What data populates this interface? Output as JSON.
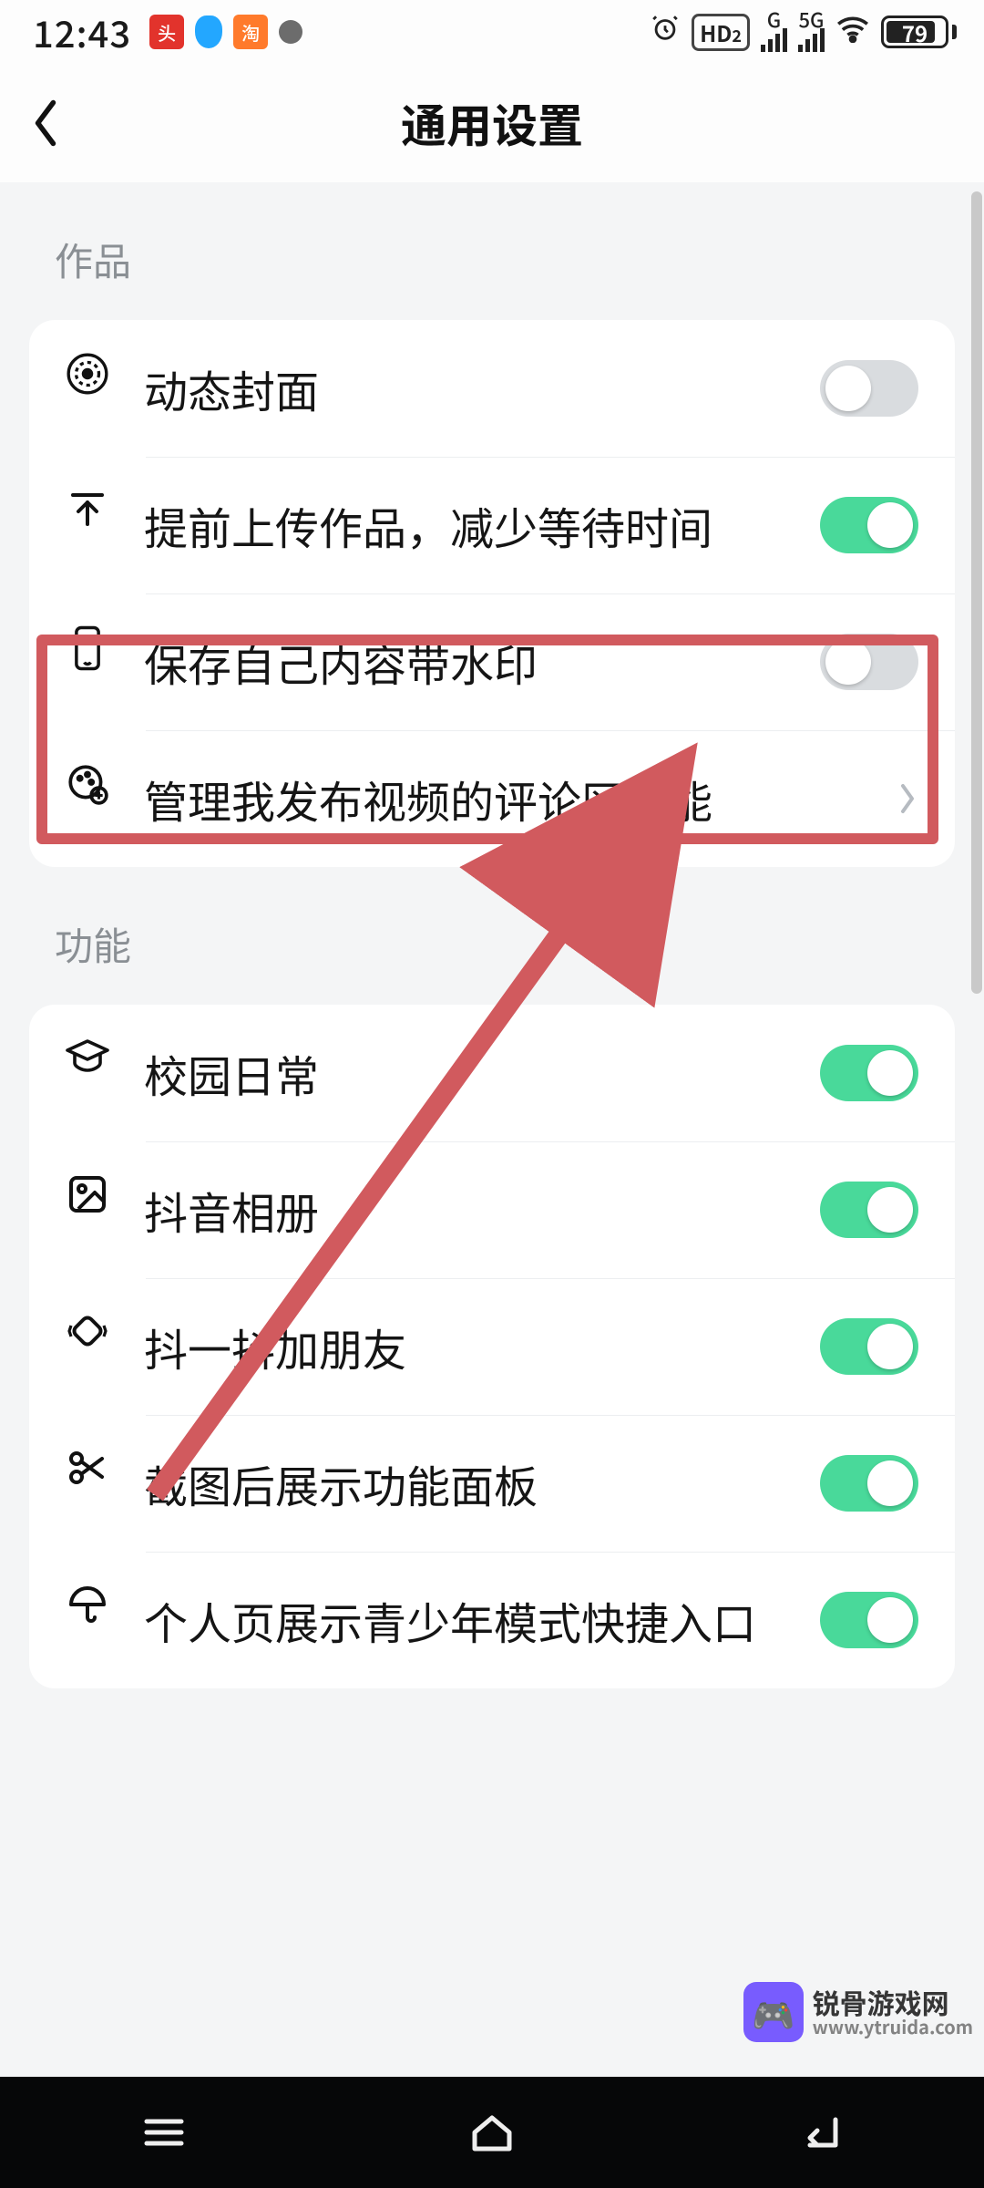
{
  "status": {
    "time": "12:43",
    "hd_label": "HD",
    "hd_sub": "2",
    "net_left_label": "G",
    "net_right_label": "5G",
    "battery_pct": "79"
  },
  "header": {
    "title": "通用设置"
  },
  "sections": [
    {
      "label": "作品",
      "rows": [
        {
          "icon": "target",
          "label": "动态封面",
          "type": "toggle",
          "on": false
        },
        {
          "icon": "upload",
          "label": "提前上传作品，减少等待时间",
          "type": "toggle",
          "on": true
        },
        {
          "icon": "phone",
          "label": "保存自己内容带水印",
          "type": "toggle",
          "on": false,
          "highlighted": true
        },
        {
          "icon": "palette",
          "label": "管理我发布视频的评论区功能",
          "type": "nav"
        }
      ]
    },
    {
      "label": "功能",
      "rows": [
        {
          "icon": "gradcap",
          "label": "校园日常",
          "type": "toggle",
          "on": true
        },
        {
          "icon": "image",
          "label": "抖音相册",
          "type": "toggle",
          "on": true
        },
        {
          "icon": "shake",
          "label": "抖一抖加朋友",
          "type": "toggle",
          "on": true
        },
        {
          "icon": "scissors",
          "label": "截图后展示功能面板",
          "type": "toggle",
          "on": true
        },
        {
          "icon": "umbrella",
          "label": "个人页展示青少年模式快捷入口",
          "type": "toggle",
          "on": true
        }
      ]
    }
  ],
  "watermark": {
    "line1": "锐骨游戏网",
    "line2": "www.ytruida.com"
  }
}
